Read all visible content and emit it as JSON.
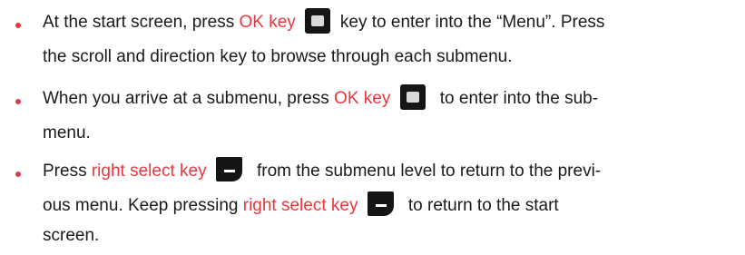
{
  "colors": {
    "text": "#1a1a1a",
    "highlight": "#e8373f",
    "bullet": "#e8373f",
    "key": "#151515"
  },
  "icons": {
    "ok_key": "ok-key-icon",
    "right_select_key": "right-select-key-icon"
  },
  "instructions": [
    {
      "l1_a": "At the start screen, press ",
      "l1_b": "OK key",
      "l1_c": " key to enter into the “Menu”. Press",
      "l2": "the scroll and direction key to browse through each submenu."
    },
    {
      "l1_a": "When you arrive at a submenu, press ",
      "l1_b": "OK key",
      "l1_c": " to enter into the sub-",
      "l2": "menu."
    },
    {
      "l1_a": "Press ",
      "l1_b": "right select key",
      "l1_c": " from the submenu level to return to the previ-",
      "l2_a": "ous menu. Keep pressing ",
      "l2_b": "right select key",
      "l2_c": " to return to the start",
      "l3": "screen."
    }
  ]
}
